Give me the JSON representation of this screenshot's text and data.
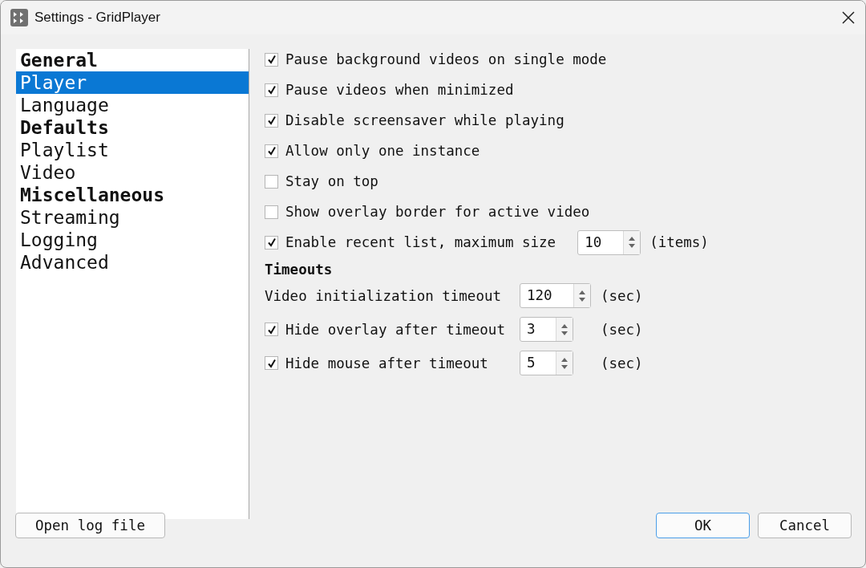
{
  "window": {
    "title": "Settings - GridPlayer"
  },
  "sidebar": {
    "items": [
      {
        "label": "General",
        "kind": "heading",
        "selected": false
      },
      {
        "label": "Player",
        "kind": "item",
        "selected": true
      },
      {
        "label": "Language",
        "kind": "item",
        "selected": false
      },
      {
        "label": "Defaults",
        "kind": "heading",
        "selected": false
      },
      {
        "label": "Playlist",
        "kind": "item",
        "selected": false
      },
      {
        "label": "Video",
        "kind": "item",
        "selected": false
      },
      {
        "label": "Miscellaneous",
        "kind": "heading",
        "selected": false
      },
      {
        "label": "Streaming",
        "kind": "item",
        "selected": false
      },
      {
        "label": "Logging",
        "kind": "item",
        "selected": false
      },
      {
        "label": "Advanced",
        "kind": "item",
        "selected": false
      }
    ]
  },
  "options": [
    {
      "label": "Pause background videos on single mode",
      "checked": true
    },
    {
      "label": "Pause videos when minimized",
      "checked": true
    },
    {
      "label": "Disable screensaver while playing",
      "checked": true
    },
    {
      "label": "Allow only one instance",
      "checked": true
    },
    {
      "label": "Stay on top",
      "checked": false
    },
    {
      "label": "Show overlay border for active video",
      "checked": false
    },
    {
      "label": "Enable recent list, maximum size",
      "checked": true,
      "value": "10",
      "unit": "(items)"
    }
  ],
  "timeouts": {
    "title": "Timeouts",
    "rows": [
      {
        "kind": "plain",
        "label": "Video initialization timeout",
        "value": "120",
        "unit": "(sec)"
      },
      {
        "kind": "check",
        "label": "Hide overlay after timeout",
        "checked": true,
        "value": "3",
        "unit": "(sec)"
      },
      {
        "kind": "check",
        "label": "Hide mouse after timeout",
        "checked": true,
        "value": "5",
        "unit": "(sec)"
      }
    ]
  },
  "buttons": {
    "left": "Open log file",
    "ok": "OK",
    "cancel": "Cancel"
  }
}
